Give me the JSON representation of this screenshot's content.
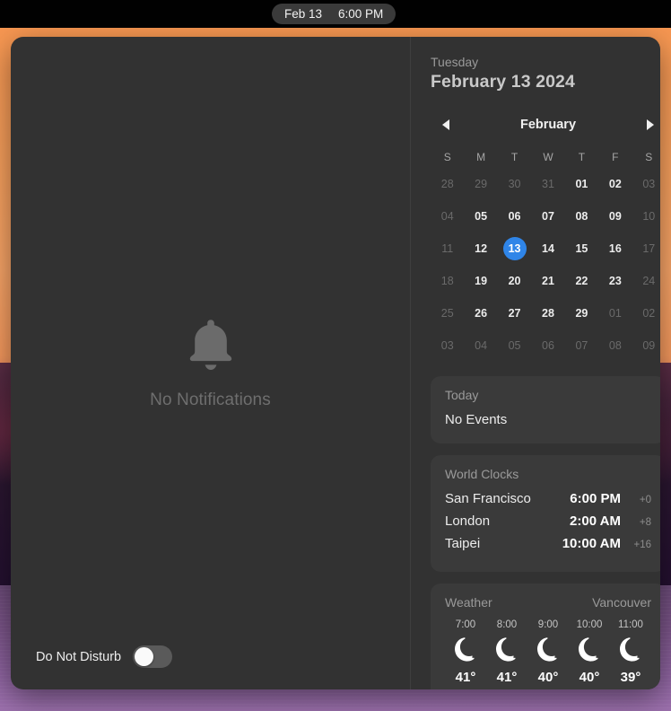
{
  "menubar": {
    "clock_date": "Feb 13",
    "clock_time": "6:00 PM"
  },
  "notifications": {
    "bell_icon": "bell-icon",
    "empty_label": "No Notifications",
    "dnd_label": "Do Not Disturb",
    "dnd_state": "off"
  },
  "date_header": {
    "weekday": "Tuesday",
    "full_date": "February 13 2024"
  },
  "calendar": {
    "month": "February",
    "prev_icon": "chevron-left-icon",
    "next_icon": "chevron-right-icon",
    "weekdays": [
      "S",
      "M",
      "T",
      "W",
      "T",
      "F",
      "S"
    ],
    "today": "13",
    "accent_color": "#2f85e8",
    "weeks": [
      [
        {
          "d": "28",
          "dim": true
        },
        {
          "d": "29",
          "dim": true
        },
        {
          "d": "30",
          "dim": true
        },
        {
          "d": "31",
          "dim": true
        },
        {
          "d": "01",
          "dim": false
        },
        {
          "d": "02",
          "dim": false
        },
        {
          "d": "03",
          "dim": true
        }
      ],
      [
        {
          "d": "04",
          "dim": true
        },
        {
          "d": "05",
          "dim": false
        },
        {
          "d": "06",
          "dim": false
        },
        {
          "d": "07",
          "dim": false
        },
        {
          "d": "08",
          "dim": false
        },
        {
          "d": "09",
          "dim": false
        },
        {
          "d": "10",
          "dim": true
        }
      ],
      [
        {
          "d": "11",
          "dim": true
        },
        {
          "d": "12",
          "dim": false
        },
        {
          "d": "13",
          "dim": false,
          "today": true
        },
        {
          "d": "14",
          "dim": false
        },
        {
          "d": "15",
          "dim": false
        },
        {
          "d": "16",
          "dim": false
        },
        {
          "d": "17",
          "dim": true
        }
      ],
      [
        {
          "d": "18",
          "dim": true
        },
        {
          "d": "19",
          "dim": false
        },
        {
          "d": "20",
          "dim": false
        },
        {
          "d": "21",
          "dim": false
        },
        {
          "d": "22",
          "dim": false
        },
        {
          "d": "23",
          "dim": false
        },
        {
          "d": "24",
          "dim": true
        }
      ],
      [
        {
          "d": "25",
          "dim": true
        },
        {
          "d": "26",
          "dim": false
        },
        {
          "d": "27",
          "dim": false
        },
        {
          "d": "28",
          "dim": false
        },
        {
          "d": "29",
          "dim": false
        },
        {
          "d": "01",
          "dim": true
        },
        {
          "d": "02",
          "dim": true
        }
      ],
      [
        {
          "d": "03",
          "dim": true
        },
        {
          "d": "04",
          "dim": true
        },
        {
          "d": "05",
          "dim": true
        },
        {
          "d": "06",
          "dim": true
        },
        {
          "d": "07",
          "dim": true
        },
        {
          "d": "08",
          "dim": true
        },
        {
          "d": "09",
          "dim": true
        }
      ]
    ]
  },
  "events_widget": {
    "title": "Today",
    "body": "No Events"
  },
  "world_clocks_widget": {
    "title": "World Clocks",
    "rows": [
      {
        "city": "San Francisco",
        "time": "6:00 PM",
        "offset": "+0"
      },
      {
        "city": "London",
        "time": "2:00 AM",
        "offset": "+8"
      },
      {
        "city": "Taipei",
        "time": "10:00 AM",
        "offset": "+16"
      }
    ]
  },
  "weather_widget": {
    "title": "Weather",
    "location": "Vancouver",
    "hours": [
      {
        "time": "7:00",
        "icon": "crescent-moon-icon",
        "temp": "41°"
      },
      {
        "time": "8:00",
        "icon": "crescent-moon-icon",
        "temp": "41°"
      },
      {
        "time": "9:00",
        "icon": "crescent-moon-icon",
        "temp": "40°"
      },
      {
        "time": "10:00",
        "icon": "crescent-moon-icon",
        "temp": "40°"
      },
      {
        "time": "11:00",
        "icon": "crescent-moon-icon",
        "temp": "39°"
      }
    ]
  }
}
